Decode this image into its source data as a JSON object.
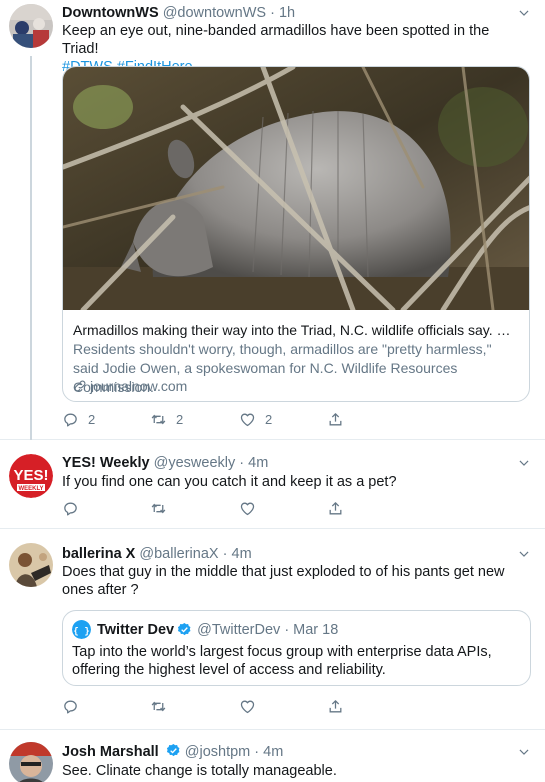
{
  "colors": {
    "link": "#1b95e0",
    "secondary": "#657786",
    "verified": "#1da1f2",
    "border": "#e6ecf0"
  },
  "tweets": [
    {
      "name": "DowntownWS",
      "handle": "@downtownWS",
      "dot": "·",
      "time": "1h",
      "text": "Keep an eye out, nine-banded armadillos have been spotted in the Triad!",
      "hashtags": "#DTWS #FindItHere",
      "card": {
        "title": "Armadillos making their way into the Triad, N.C. wildlife officials say. Blam...",
        "description": "Residents shouldn't worry, though, armadillos are \"pretty harmless,\" said Jodie Owen, a spokeswoman for N.C. Wildlife Resources Commission.",
        "domain": "journalnow.com"
      },
      "actions": {
        "reply_count": "2",
        "retweet_count": "2",
        "like_count": "2"
      }
    },
    {
      "name": "YES! Weekly",
      "handle": "@yesweekly",
      "dot": "·",
      "time": "4m",
      "text": "If you find one can you catch it and keep it as a pet?",
      "avatar_text": "YES!",
      "avatar_subtext": "WEEKLY"
    },
    {
      "name": "ballerina X",
      "handle": "@ballerinaX",
      "dot": "·",
      "time": "4m",
      "text": "Does that guy in the middle that just exploded to of his pants get new ones after ?",
      "quote": {
        "name": "Twitter Dev",
        "handle": "@TwitterDev",
        "dot": "·",
        "time": "Mar 18",
        "text": "Tap into the world’s largest focus group with enterprise data APIs, offering the highest level of access and reliability."
      }
    },
    {
      "name": "Josh Marshall",
      "handle": "@joshtpm",
      "dot": "·",
      "time": "4m",
      "text": "See. Clinate change is totally manageable."
    }
  ]
}
